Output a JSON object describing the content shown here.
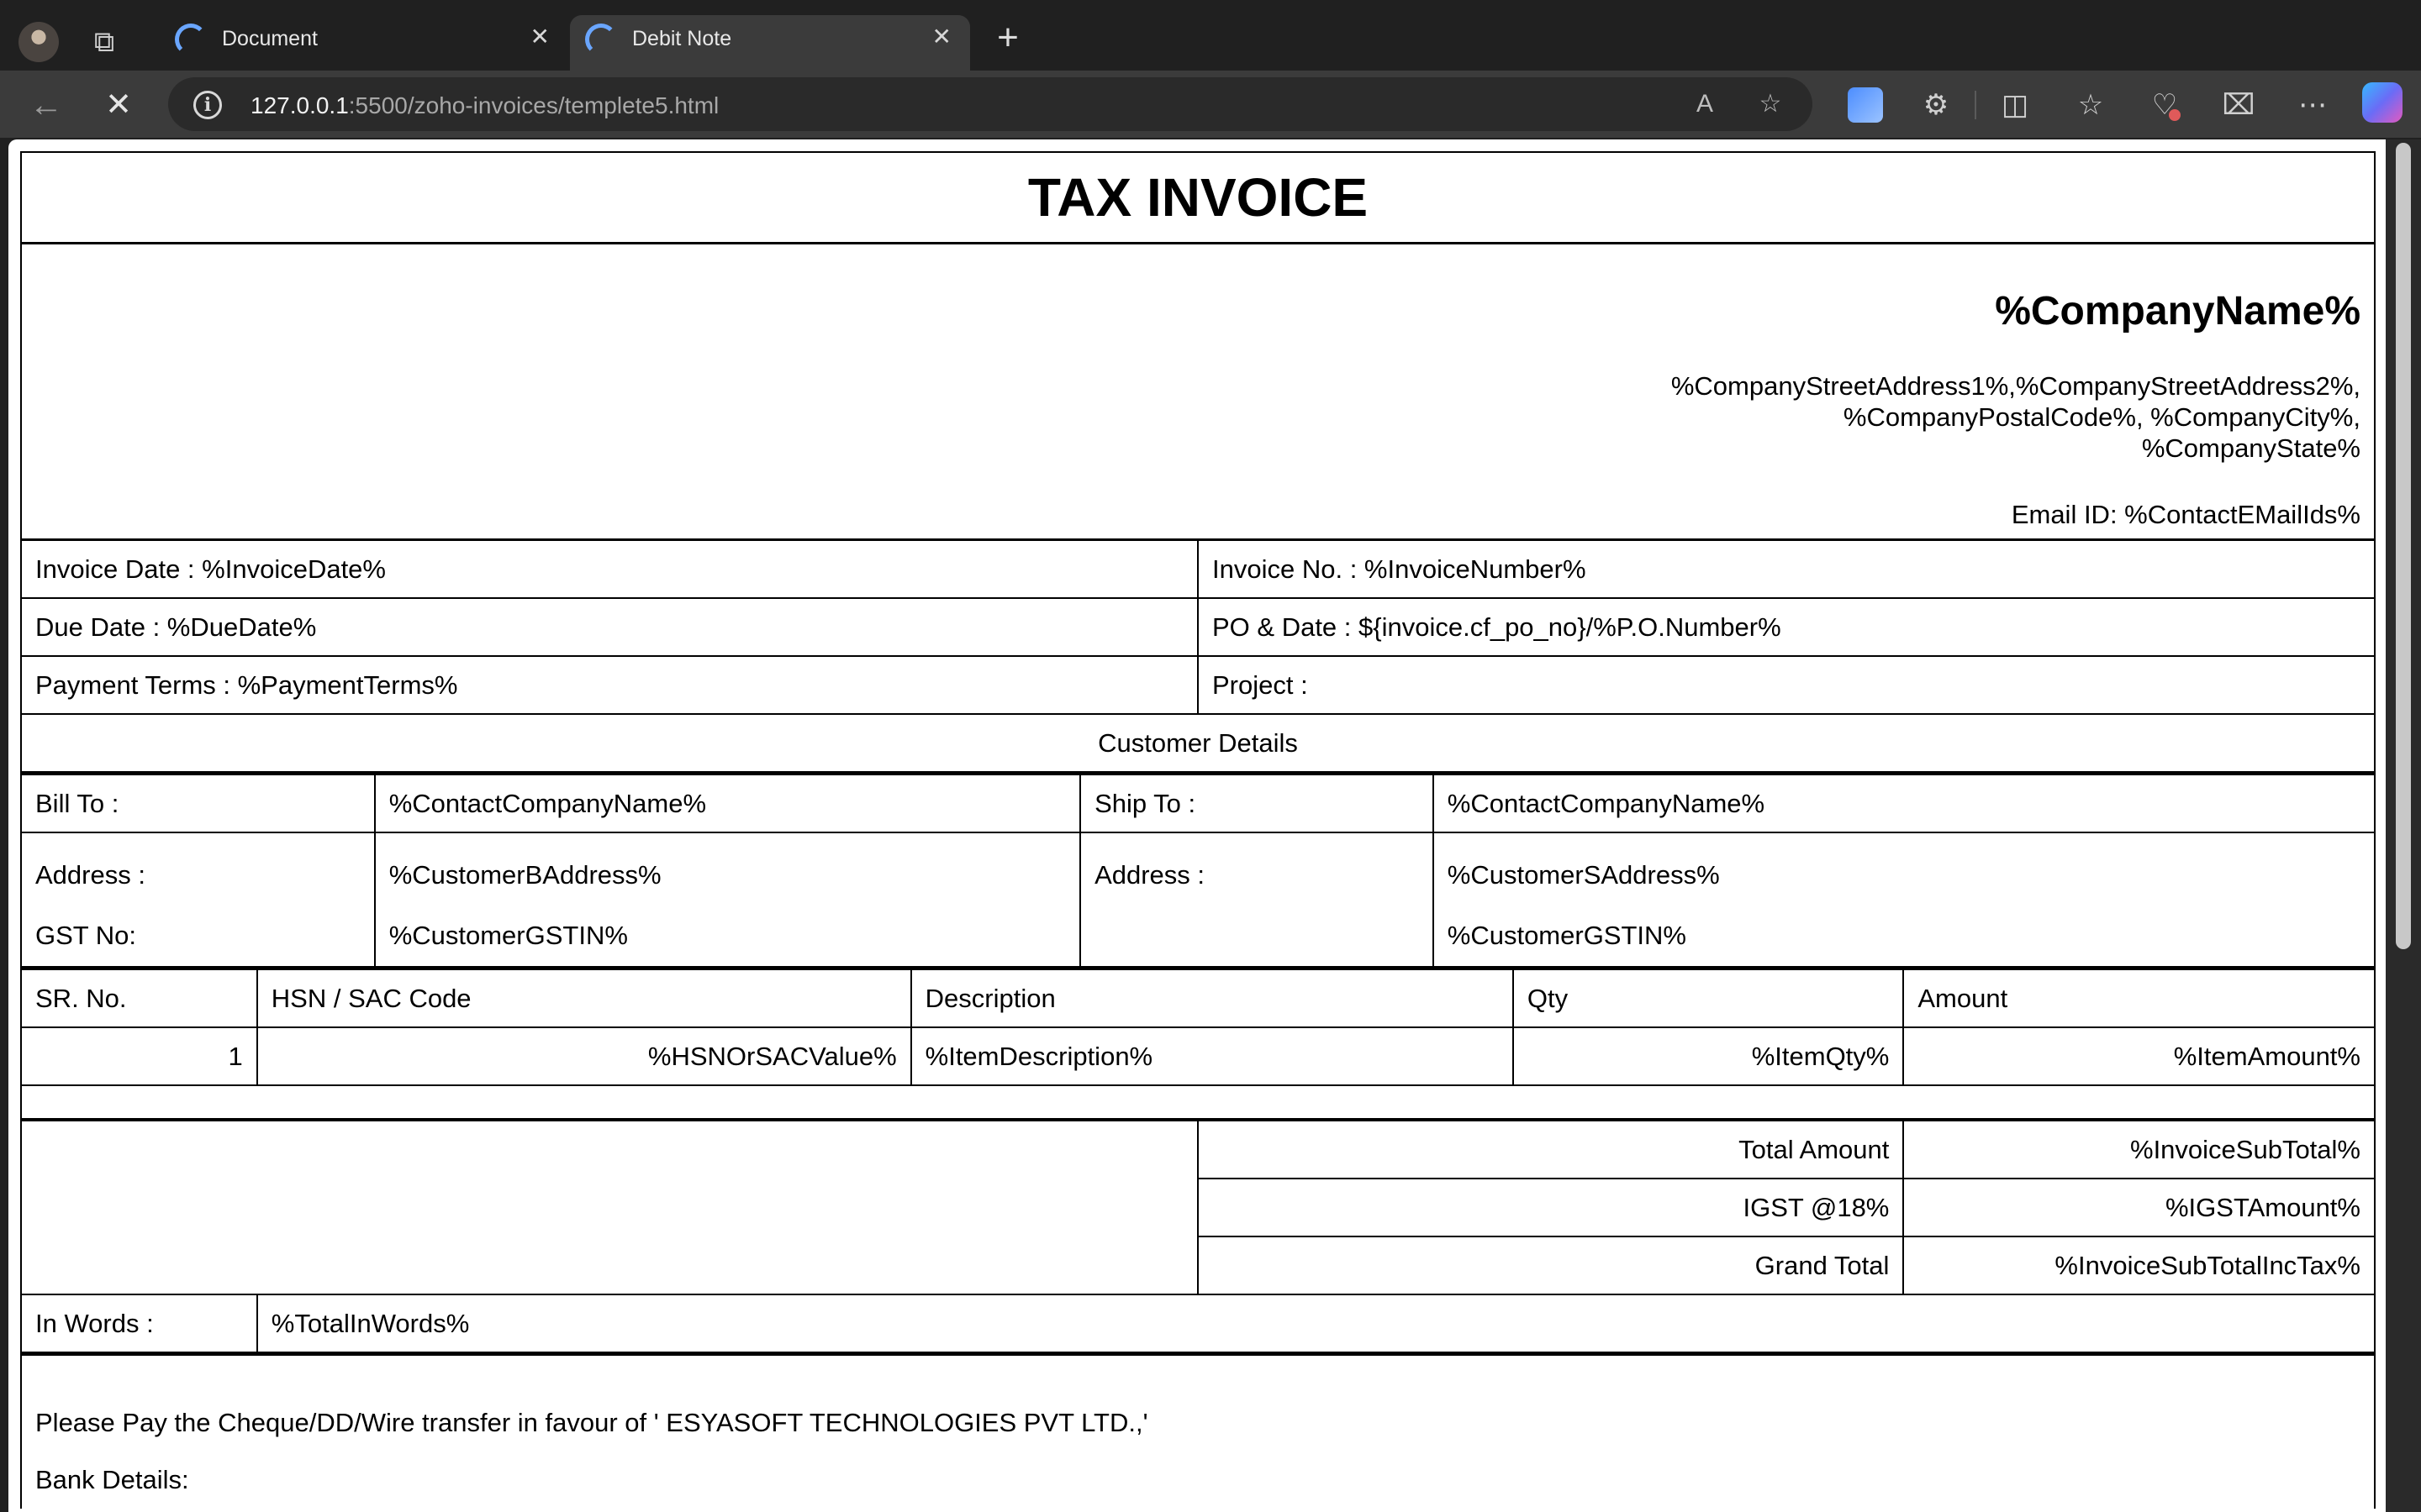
{
  "browser": {
    "tabs": [
      {
        "title": "Document",
        "active": false
      },
      {
        "title": "Debit Note",
        "active": true
      }
    ],
    "url_host": "127.0.0.1",
    "url_rest": ":5500/zoho-invoices/templete5.html"
  },
  "invoice": {
    "title": "TAX INVOICE",
    "company": {
      "name": "%CompanyName%",
      "address_line1": "%CompanyStreetAddress1%,%CompanyStreetAddress2%,",
      "address_line2": "%CompanyPostalCode%, %CompanyCity%,",
      "address_line3": "%CompanyState%",
      "email": "Email ID: %ContactEMailIds%"
    },
    "meta": {
      "invoice_date": "Invoice Date : %InvoiceDate%",
      "invoice_no": "Invoice No. : %InvoiceNumber%",
      "due_date": "Due Date : %DueDate%",
      "po_date": "PO & Date : ${invoice.cf_po_no}/%P.O.Number%",
      "payment_terms": "Payment Terms : %PaymentTerms%",
      "project": "Project :"
    },
    "customer": {
      "heading": "Customer Details",
      "bill_to_label": "Bill To :",
      "bill_to_value": "%ContactCompanyName%",
      "ship_to_label": "Ship To :",
      "ship_to_value": "%ContactCompanyName%",
      "address_label": "Address :",
      "b_address": "%CustomerBAddress%",
      "s_address_label": "Address :",
      "s_address": "%CustomerSAddress%",
      "gst_label": "GST No:",
      "b_gstin": "%CustomerGSTIN%",
      "s_gstin": "%CustomerGSTIN%"
    },
    "items": {
      "headers": [
        "SR. No.",
        "HSN / SAC Code",
        "Description",
        "Qty",
        "Amount"
      ],
      "rows": [
        [
          "1",
          "%HSNOrSACValue%",
          "%ItemDescription%",
          "%ItemQty%",
          "%ItemAmount%"
        ]
      ]
    },
    "totals": {
      "total_label": "Total Amount",
      "total_value": "%InvoiceSubTotal%",
      "igst_label": "IGST @18%",
      "igst_value": "%IGSTAmount%",
      "grand_label": "Grand Total",
      "grand_value": "%InvoiceSubTotalIncTax%",
      "words_label": "In Words :",
      "words_value": "%TotalInWords%"
    },
    "footer": {
      "payment_note": "Please Pay the Cheque/DD/Wire transfer in favour of ' ESYASOFT TECHNOLOGIES PVT LTD.,'",
      "bank_details": "Bank Details:"
    }
  }
}
